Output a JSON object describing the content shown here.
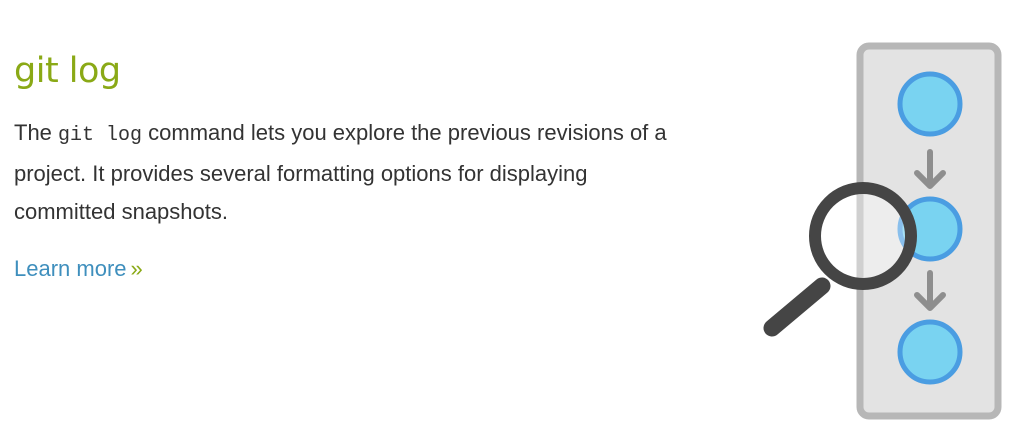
{
  "section": {
    "title": "git log",
    "description": {
      "prefix": "The ",
      "code": "git log",
      "suffix": " command lets you explore the previous revisions of a project. It provides several formatting options for displaying committed snapshots."
    },
    "link": {
      "label": "Learn more",
      "arrow": "»"
    }
  },
  "illustration": {
    "icons": [
      "commit-node-icon",
      "down-arrow-icon",
      "magnifying-glass-icon"
    ]
  },
  "colors": {
    "title": "#8aa916",
    "text": "#333333",
    "link": "#3f8fbd",
    "link_arrow": "#8aa916",
    "panel_fill": "#e3e3e3",
    "panel_border": "#b7b7b7",
    "node_fill": "#79d3f1",
    "node_border": "#4a9de2",
    "arrow": "#8e8e8e",
    "magnifier": "#454545"
  }
}
